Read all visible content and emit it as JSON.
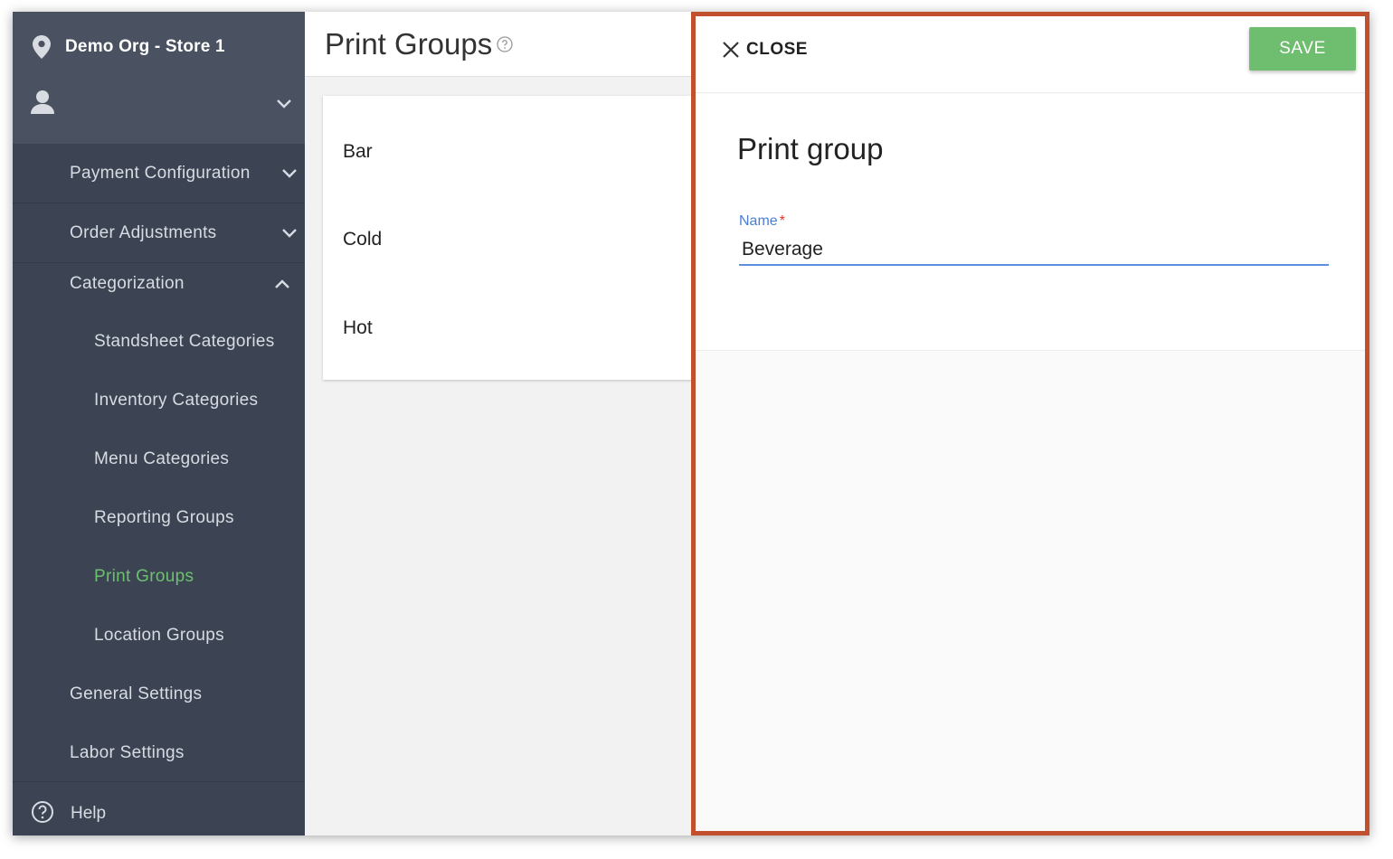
{
  "sidebar": {
    "store_name": "Demo Org - Store 1",
    "nav": [
      {
        "label": "Payment Configuration",
        "icon": "chevron-down-icon"
      },
      {
        "label": "Order Adjustments",
        "icon": "chevron-down-icon"
      },
      {
        "label": "Categorization",
        "icon": "chevron-up-icon"
      }
    ],
    "sub_items": [
      {
        "label": "Standsheet Categories"
      },
      {
        "label": "Inventory Categories"
      },
      {
        "label": "Menu Categories"
      },
      {
        "label": "Reporting Groups"
      },
      {
        "label": "Print Groups",
        "active": true
      },
      {
        "label": "Location Groups"
      }
    ],
    "bottom_items": [
      {
        "label": "General Settings"
      },
      {
        "label": "Labor Settings"
      }
    ],
    "help_label": "Help"
  },
  "main": {
    "title": "Print Groups",
    "items": [
      "Bar",
      "Cold",
      "Hot"
    ]
  },
  "panel": {
    "close_label": "CLOSE",
    "save_label": "SAVE",
    "form_title": "Print group",
    "name_label": "Name",
    "name_required": "*",
    "name_value": "Beverage"
  },
  "colors": {
    "sidebar_bg": "#3c4453",
    "active_nav": "#6cc070",
    "save_button": "#6fbd6e",
    "panel_border": "#c0502e",
    "focus_underline": "#5b8fe0"
  }
}
